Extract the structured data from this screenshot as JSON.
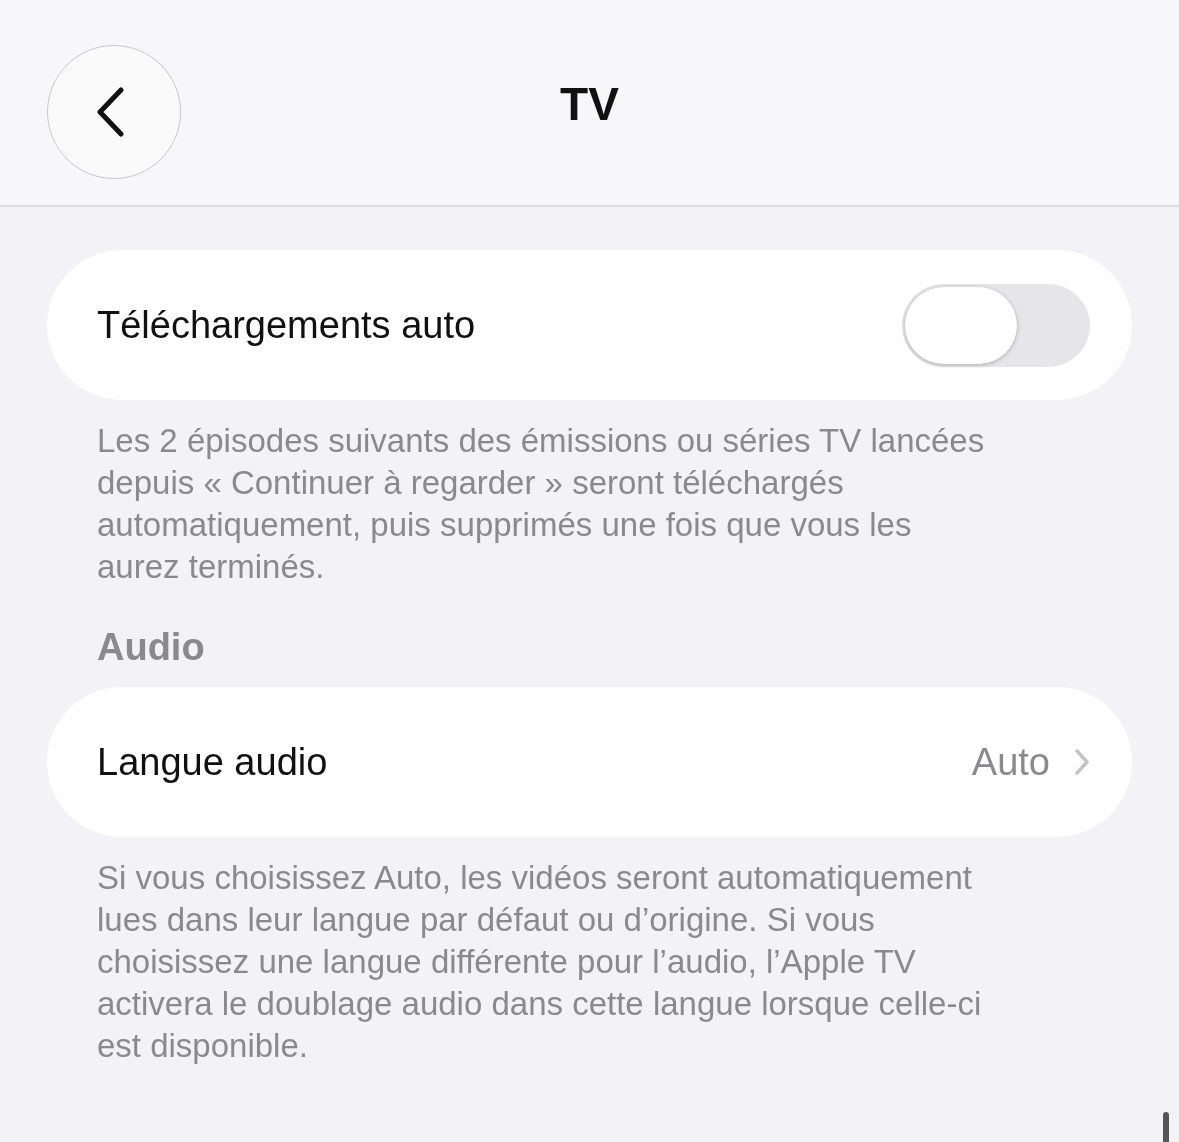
{
  "header": {
    "title": "TV"
  },
  "sections": [
    {
      "row": {
        "kind": "toggle",
        "label": "Téléchargements auto",
        "on": false
      },
      "footer": "Les 2 épisodes suivants des émissions ou séries TV lancées depuis « Continuer à regarder » seront téléchargés automatiquement, puis supprimés une fois que vous les aurez terminés."
    },
    {
      "header": "Audio",
      "row": {
        "kind": "link",
        "label": "Langue audio",
        "value": "Auto"
      },
      "footer": "Si vous choisissez Auto, les vidéos seront automatiquement lues dans leur langue par défaut ou d’origine. Si vous choisissez une langue différente pour l’audio, l’Apple TV activera le doublage audio dans cette langue lorsque celle-ci est disponible."
    }
  ]
}
